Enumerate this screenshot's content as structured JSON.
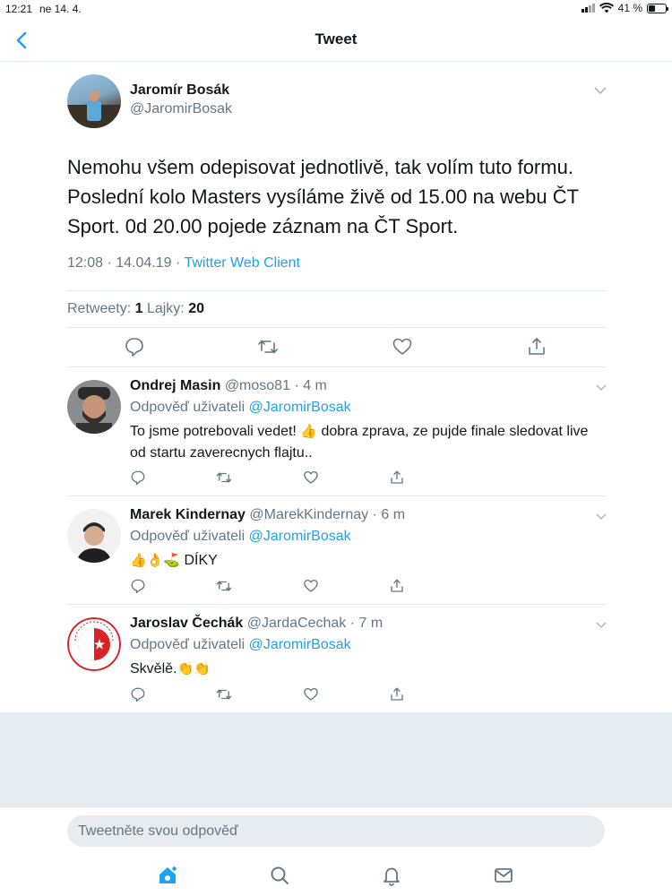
{
  "status_bar": {
    "time": "12:21",
    "date": "ne 14. 4.",
    "battery": "41 %"
  },
  "nav": {
    "title": "Tweet"
  },
  "tweet": {
    "author_name": "Jaromír Bosák",
    "author_handle": "@JaromirBosak",
    "text": "Nemohu všem odepisovat jednotlivě, tak volím tuto formu. Poslední kolo Masters vysíláme živě od 15.00 na webu ČT Sport. 0d 20.00 pojede záznam na ČT Sport.",
    "timestamp": "12:08 · 14.04.19 · ",
    "client": "Twitter Web Client",
    "retweets_label": "Retweety:",
    "retweets": "1",
    "likes_label": "Lajky:",
    "likes": "20"
  },
  "replies": [
    {
      "name": "Ondrej Masin",
      "handle": "@moso81",
      "time": "· 4 m",
      "reply_to_label": "Odpověď uživateli ",
      "reply_to": "@JaromirBosak",
      "text_before": "To jsme potrebovali vedet! ",
      "emoji": "👍",
      "text_after": " dobra zprava, ze pujde finale sledovat live od startu zaverecnych flajtu.."
    },
    {
      "name": "Marek Kindernay",
      "handle": "@MarekKindernay",
      "time": "· 6 m",
      "reply_to_label": "Odpověď uživateli ",
      "reply_to": "@JaromirBosak",
      "emoji": "👍👌⛳",
      "text_after": " DÍKY"
    },
    {
      "name": "Jaroslav Čechák",
      "handle": "@JardaCechak",
      "time": "· 7 m",
      "reply_to_label": "Odpověď uživateli ",
      "reply_to": "@JaromirBosak",
      "text_before": "Skvělě.",
      "emoji": "👏👏",
      "avatar_logo_text": "SK SLAVIA PRAHA FOTBAL"
    }
  ],
  "compose": {
    "placeholder": "Tweetněte svou odpověď"
  },
  "icons": {
    "back": "chevron-left-icon",
    "reply": "reply-icon",
    "retweet": "retweet-icon",
    "like": "heart-icon",
    "share": "share-icon",
    "home": "home-icon",
    "search": "search-icon",
    "notifications": "bell-icon",
    "messages": "mail-icon"
  },
  "colors": {
    "accent": "#1da1f2",
    "muted": "#657786",
    "text": "#14171a",
    "divider": "#e1e8ed",
    "background_gray": "#e6ecf0"
  }
}
